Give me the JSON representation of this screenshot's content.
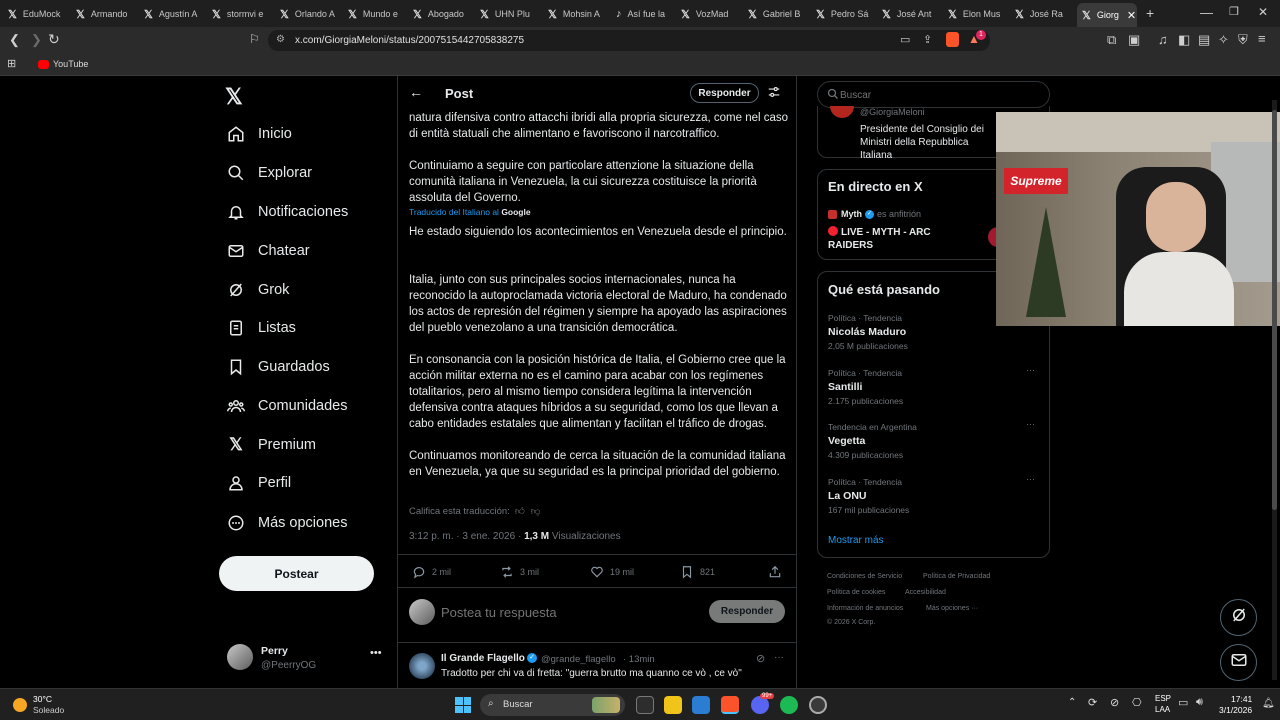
{
  "browser": {
    "tabs": [
      "EduMock",
      "Armando",
      "Agustín A",
      "stormvi e",
      "Orlando A",
      "Mundo e",
      "Abogado",
      "UHN Plu",
      "Mohsin A",
      "Así fue la",
      "VozMad",
      "Gabriel B",
      "Pedro Sá",
      "José Ant",
      "Elon Mus",
      "José Ra",
      "Giorg"
    ],
    "url": "x.com/GiorgiaMeloni/status/2007515442705838275",
    "bookmark": "YouTube",
    "ext_badge": "1"
  },
  "nav": {
    "items": [
      "Inicio",
      "Explorar",
      "Notificaciones",
      "Chatear",
      "Grok",
      "Listas",
      "Guardados",
      "Comunidades",
      "Premium",
      "Perfil",
      "Más opciones"
    ],
    "post_button": "Postear",
    "user_name": "Perry",
    "user_handle": "@PeerryOG"
  },
  "header": {
    "title": "Post",
    "reply_button": "Responder"
  },
  "post": {
    "italian_1": "natura difensiva contro attacchi ibridi alla propria sicurezza, come nel caso di entità statuali che alimentano e favoriscono il narcotraffico.",
    "italian_2": "Continuiamo a seguire con particolare attenzione la situazione della comunità italiana in Venezuela, la cui sicurezza costituisce la priorità assoluta del Governo.",
    "translated_by": "Traducido del Italiano al",
    "google": "Google",
    "es_1": "He estado siguiendo los acontecimientos en Venezuela desde el principio.",
    "es_2": "Italia, junto con sus principales socios internacionales, nunca ha reconocido la autoproclamada victoria electoral de Maduro, ha condenado los actos de represión del régimen y siempre ha apoyado las aspiraciones del pueblo venezolano a una transición democrática.",
    "es_3": "En consonancia con la posición histórica de Italia, el Gobierno cree que la acción militar externa no es el camino para acabar con los regímenes totalitarios, pero al mismo tiempo considera legítima la intervención defensiva contra ataques híbridos a su seguridad, como los que llevan a cabo entidades estatales que alimentan y facilitan el tráfico de drogas.",
    "es_4": "Continuamos monitoreando de cerca la situación de la comunidad italiana en Venezuela, ya que su seguridad es la principal prioridad del gobierno.",
    "rate": "Califica esta traducción:",
    "time": "3:12 p. m. · 3 ene. 2026 · ",
    "views_count": "1,3 M",
    "views_label": " Visualizaciones",
    "replies": "2 mil",
    "reposts": "3 mil",
    "likes": "19 mil",
    "bookmarks": "821"
  },
  "reply_box": {
    "placeholder": "Postea tu respuesta",
    "button": "Responder"
  },
  "reply": {
    "name": "Il Grande Flagello",
    "handle": "@grande_flagello",
    "time": "· 13min",
    "text": "Tradotto per chi va di fretta: \"guerra brutto ma quanno ce vò , ce vò\""
  },
  "right": {
    "search_placeholder": "Buscar",
    "profile_handle": "@GiorgiaMeloni",
    "profile_bio": "Presidente del Consiglio dei Ministri della Repubblica Italiana",
    "live_title": "En directo en X",
    "live_host": "Myth",
    "live_host_suffix": "es anfitrión",
    "live_text": "LIVE - MYTH - ARC RAIDERS",
    "trends_title": "Qué está pasando",
    "trends": [
      {
        "category": "Política · Tendencia",
        "name": "Nicolás Maduro",
        "count": "2,05 M publicaciones"
      },
      {
        "category": "Política · Tendencia",
        "name": "Santilli",
        "count": "2.175 publicaciones"
      },
      {
        "category": "Tendencia en Argentina",
        "name": "Vegetta",
        "count": "4.309 publicaciones"
      },
      {
        "category": "Política · Tendencia",
        "name": "La ONU",
        "count": "167 mil publicaciones"
      }
    ],
    "show_more": "Mostrar más",
    "footer": [
      "Condiciones de Servicio",
      "Política de Privacidad",
      "Política de cookies",
      "Accesibilidad",
      "Información de anuncios",
      "Más opciones ···",
      "© 2026 X Corp."
    ]
  },
  "webcam": {
    "sign": "Supreme"
  },
  "taskbar": {
    "temp": "30°C",
    "weather": "Soleado",
    "search": "Buscar",
    "lang": "ESP",
    "lang2": "LAA",
    "time": "17:41",
    "date": "3/1/2026",
    "discord_badge": "99+"
  },
  "colors": {
    "accent": "#1d9bf0",
    "live_red": "#f4212e",
    "muted": "#71767b",
    "border": "#2f3336"
  }
}
